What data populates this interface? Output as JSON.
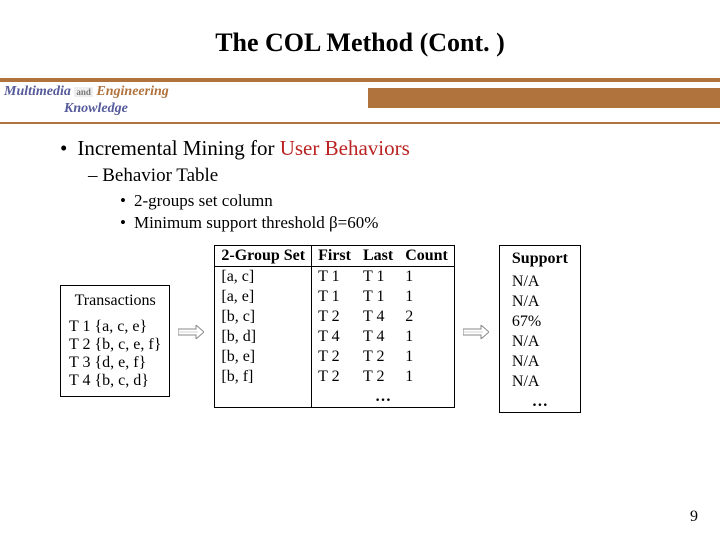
{
  "title": "The COL Method (Cont. )",
  "banner": {
    "line1_a": "Multimedia",
    "line1_and": "and",
    "line1_b": "Engineering",
    "line2": "Knowledge"
  },
  "bullets": {
    "b1_prefix": "Incremental Mining for ",
    "b1_red": "User Behaviors",
    "b2": "Behavior Table",
    "b3a": "2-groups set column",
    "b3b": "Minimum support threshold β=60%"
  },
  "transactions": {
    "header": "Transactions",
    "rows": [
      "T 1 {a, c, e}",
      "T 2 {b, c, e, f}",
      "T 3 {d, e, f}",
      "T 4 {b, c, d}"
    ]
  },
  "mid": {
    "h_gs": "2-Group Set",
    "h_first": "First",
    "h_last": "Last",
    "h_count": "Count",
    "rows": [
      {
        "gs": "[a, c]",
        "first": "T 1",
        "last": "T 1",
        "count": "1"
      },
      {
        "gs": "[a, e]",
        "first": "T 1",
        "last": "T 1",
        "count": "1"
      },
      {
        "gs": "[b, c]",
        "first": "T 2",
        "last": "T 4",
        "count": "2"
      },
      {
        "gs": "[b, d]",
        "first": "T 4",
        "last": "T 4",
        "count": "1"
      },
      {
        "gs": "[b, e]",
        "first": "T 2",
        "last": "T 2",
        "count": "1"
      },
      {
        "gs": "[b, f]",
        "first": "T 2",
        "last": "T 2",
        "count": "1"
      }
    ],
    "ellipsis": "…"
  },
  "support": {
    "header": "Support",
    "rows": [
      "N/A",
      "N/A",
      "67%",
      "N/A",
      "N/A",
      "N/A"
    ],
    "ellipsis": "…"
  },
  "page": "9"
}
